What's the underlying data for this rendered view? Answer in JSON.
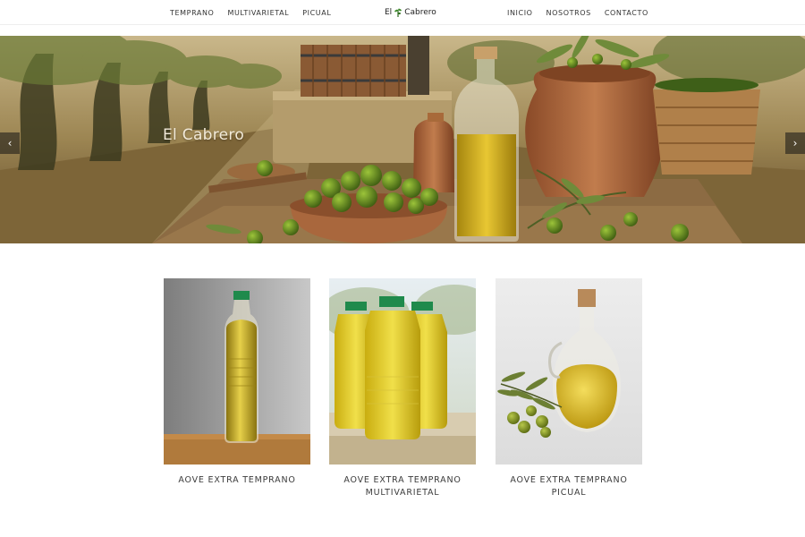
{
  "nav": {
    "left_items": [
      {
        "label": "TEMPRANO"
      },
      {
        "label": "MULTIVARIETAL"
      },
      {
        "label": "PICUAL"
      }
    ],
    "logo": {
      "text_before": "El",
      "text_after": "Cabrero",
      "icon": "olive-branch-icon"
    },
    "right_items": [
      {
        "label": "INICIO"
      },
      {
        "label": "NOSOTROS"
      },
      {
        "label": "CONTACTO"
      }
    ]
  },
  "hero": {
    "title": "El Cabrero",
    "prev_icon": "chevron-left-icon",
    "next_icon": "chevron-right-icon",
    "prev_glyph": "‹",
    "next_glyph": "›"
  },
  "products": [
    {
      "name": "AOVE EXTRA TEMPRANO"
    },
    {
      "name": "AOVE EXTRA TEMPRANO\nMULTIVARIETAL"
    },
    {
      "name": "AOVE EXTRA TEMPRANO\nPICUAL"
    }
  ],
  "colors": {
    "oil": "#d8b51e",
    "olive_green": "#5e7d1e",
    "cap_green": "#1f8a4c",
    "terracotta": "#b06a3d"
  }
}
